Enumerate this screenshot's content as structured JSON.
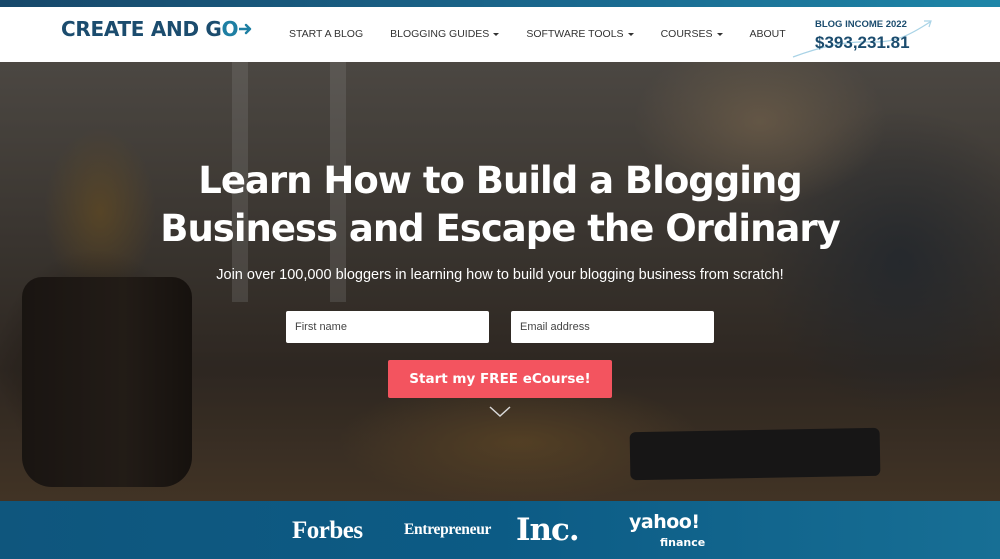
{
  "header": {
    "logo": {
      "text_main": "CREATE AND G",
      "text_accent": "O",
      "icon": "arrow-right-icon"
    },
    "nav": [
      {
        "label": "START A BLOG",
        "has_dropdown": false
      },
      {
        "label": "BLOGGING GUIDES",
        "has_dropdown": true
      },
      {
        "label": "SOFTWARE TOOLS",
        "has_dropdown": true
      },
      {
        "label": "COURSES",
        "has_dropdown": true
      },
      {
        "label": "ABOUT",
        "has_dropdown": false
      }
    ],
    "income": {
      "label": "BLOG INCOME 2022",
      "value": "$393,231.81",
      "icon": "trend-arrow-icon"
    }
  },
  "hero": {
    "headline_line1": "Learn How to Build a Blogging",
    "headline_line2": "Business and Escape the Ordinary",
    "subheadline": "Join over 100,000 bloggers in learning how to build your blogging business from scratch!",
    "form": {
      "first_name_placeholder": "First name",
      "first_name_value": "",
      "email_placeholder": "Email address",
      "email_value": "",
      "submit_label": "Start my FREE eCourse!"
    },
    "scroll_icon": "chevron-down-icon"
  },
  "press": {
    "logos": [
      "Forbes",
      "Entrepreneur",
      "Inc.",
      "yahoo!"
    ],
    "yahoo_sub": "finance"
  },
  "colors": {
    "brand_dark": "#1b4c6e",
    "brand_accent": "#1e7fa3",
    "cta": "#f3545f",
    "press_bar": "#0c5b85"
  }
}
